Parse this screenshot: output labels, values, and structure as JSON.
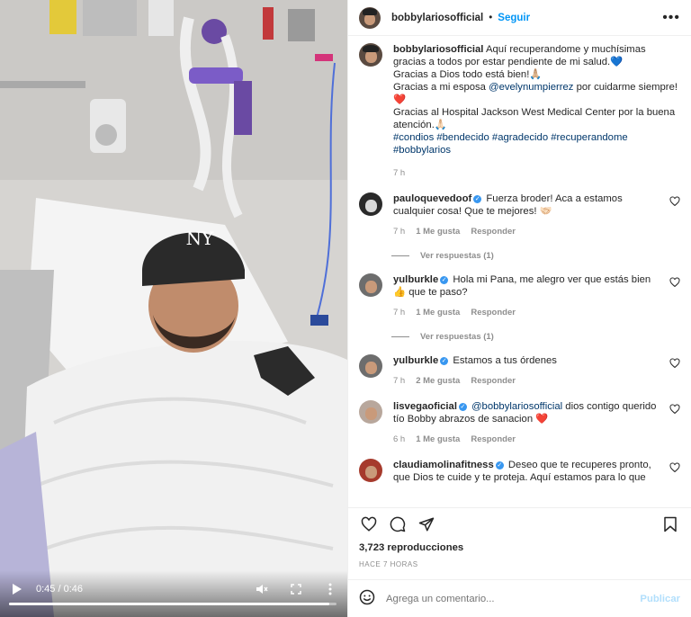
{
  "post": {
    "username": "bobbylariosofficial",
    "separator": "•",
    "follow_label": "Seguir",
    "more_icon": "more-horizontal-icon"
  },
  "video": {
    "time": "0:45 / 0:46",
    "progress": 0.978,
    "icons": [
      "play-icon",
      "mute-icon",
      "fullscreen-icon",
      "more-vertical-icon"
    ]
  },
  "caption": {
    "username": "bobbylariosofficial",
    "line1": "Aquí recuperandome y muchísimas gracias a todos por estar pendiente de mi salud.💙",
    "line2": "Gracias a Dios todo está bien!🙏🏼",
    "line3_pre": "Gracias a mi esposa ",
    "line3_mention": "@evelynumpierrez",
    "line3_post": " por cuidarme siempre!❤️",
    "line4": "Gracias al Hospital Jackson West Medical Center por la buena atención.🙏🏻",
    "hashtags": "#condios #bendecido #agradecido #recuperandome #bobbylarios",
    "time": "7 h"
  },
  "comments": [
    {
      "user": "pauloquevedoof",
      "verified": true,
      "text": "Fuerza broder! Aca a estamos cualquier cosa! Que te mejores! 🤝🏻",
      "time": "7 h",
      "likes": "1 Me gusta",
      "reply": "Responder",
      "replies": "Ver respuestas (1)"
    },
    {
      "user": "yulburkle",
      "verified": true,
      "text": "Hola mi Pana, me alegro ver que estás bien 👍 que te paso?",
      "time": "7 h",
      "likes": "1 Me gusta",
      "reply": "Responder",
      "replies": "Ver respuestas (1)"
    },
    {
      "user": "yulburkle",
      "verified": true,
      "text": "Estamos a tus órdenes",
      "time": "7 h",
      "likes": "2 Me gusta",
      "reply": "Responder"
    },
    {
      "user": "lisvegaoficial",
      "verified": true,
      "mention": "@bobbylariosofficial",
      "text": " dios contigo querido tío Bobby abrazos de sanacion ❤️",
      "time": "6 h",
      "likes": "1 Me gusta",
      "reply": "Responder"
    },
    {
      "user": "claudiamolinafitness",
      "verified": true,
      "text": "Deseo que te recuperes pronto, que Dios te cuide y te proteja. Aquí estamos para lo que"
    }
  ],
  "actions": {
    "icons": [
      "heart-icon",
      "comment-icon",
      "share-icon",
      "bookmark-icon"
    ],
    "views": "3,723 reproducciones",
    "ago": "HACE 7 HORAS"
  },
  "add_comment": {
    "placeholder": "Agrega un comentario...",
    "post_label": "Publicar"
  }
}
